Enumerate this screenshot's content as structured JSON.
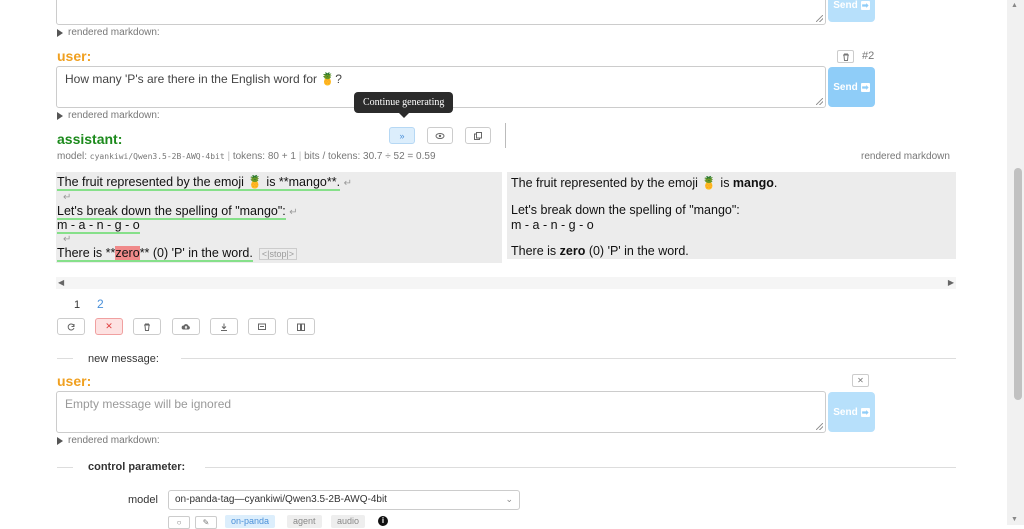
{
  "top_message": {
    "send_label": "Send",
    "rendered_markdown_label": "rendered markdown:"
  },
  "user_message": {
    "role": "user:",
    "index": "#2",
    "text": "How many 'P's are there in the English word for 🍍?",
    "send_label": "Send",
    "rendered_markdown_label": "rendered markdown:"
  },
  "assistant": {
    "role": "assistant:",
    "tooltip": "Continue generating",
    "meta": {
      "model_label": "model:",
      "model_name": "cyankiwi/Qwen3.5-2B-AWQ-4bit",
      "tokens": "tokens: 80 + 1",
      "bits": "bits / tokens: 30.7 ÷ 52 = 0.59",
      "rendered_markdown": "rendered markdown"
    },
    "raw": {
      "line1a": "The fruit represented by the emoji 🍍 is **mango**.",
      "line2": "Let's break down the spelling of \"mango\":",
      "line3": "m - a - n - g - o",
      "line4a": "There is **",
      "line4b": "zero",
      "line4c": "** (0) 'P' in the word.",
      "stop": "<|stop|>"
    },
    "rendered": {
      "line1a": "The fruit represented by the emoji 🍍 is ",
      "line1b": "mango",
      "line1c": ".",
      "line2": "Let's break down the spelling of \"mango\":",
      "line3": "m - a - n - g - o",
      "line4a": "There is ",
      "line4b": "zero",
      "line4c": " (0) 'P' in the word."
    },
    "pages": [
      "1",
      "2"
    ],
    "newline_glyph": "↵"
  },
  "new_message": {
    "section_label": "new message:",
    "role": "user:",
    "placeholder": "Empty message will be ignored",
    "send_label": "Send",
    "rendered_markdown_label": "rendered markdown:"
  },
  "control": {
    "section_label": "control parameter:",
    "model_label": "model",
    "model_value": "on-panda-tag—cyankiwi/Qwen3.5-2B-AWQ-4bit",
    "tags": [
      "on-panda",
      "agent",
      "audio"
    ]
  },
  "colors": {
    "user_role": "#f0a020",
    "assistant_role": "#1c8a1c",
    "send": "#8fcdf8",
    "token_underline": "#86e08a",
    "highlight": "#f08a8a"
  }
}
